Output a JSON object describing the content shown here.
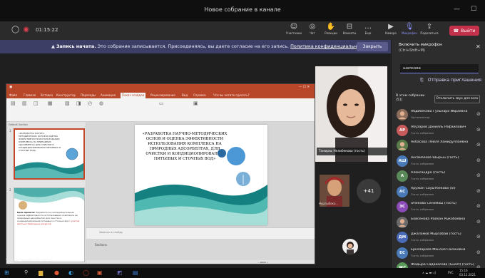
{
  "titlebar": {
    "title": "Новое собрание в канале"
  },
  "toolbar": {
    "timer": "01:15:22",
    "participants": "Участники",
    "chat": "Чат",
    "reactions": "Реакции",
    "rooms": "Комнаты",
    "more": "Еще",
    "camera": "Камера",
    "mic": "Микрофон",
    "share": "Поделиться",
    "leave": "Выйти"
  },
  "banner": {
    "bold": "Запись начата.",
    "text": "Это собрание записывается. Присоединяясь, вы даете согласие на его запись.",
    "link": "Политика конфиденциальности",
    "close": "Закрыть"
  },
  "ppt": {
    "tabs": [
      "Файл",
      "Главная",
      "Вставка",
      "Конструктор",
      "Переходы",
      "Анимация",
      "Показ слайдов",
      "Рецензирование",
      "Вид",
      "Справка",
      "Что вы хотите сделать?"
    ],
    "active_tab": "Показ слайдов",
    "slide_title": "«РАЗРАБОТКА НАУЧНО-МЕТОДИЧЕСКИХ ОСНОВ И ОЦЕНКА ЭФФЕКТИВНОСТИ ИСПОЛЬЗОВАНИЯ КОМПЛЕКСА НА ПРИРОДНЫХ АДСОРБЕНТАХ, ДЛЯ ОЧИСТКИ И КОНДИЦИОНИРОВАНИЯ ПИТЬЕВЫХ И СТОЧНЫХ ВОД»",
    "thumb1_text": "«РАЗРАБОТКА НАУЧНО-МЕТОДИЧЕСКИХ ОСНОВ И ОЦЕНКА ЭФФЕКТИВНОСТИ ИСПОЛЬЗОВАНИЯ КОМПЛЕКСА НА ПРИРОДНЫХ АДСОРБЕНТАХ ДЛЯ ОЧИСТКИ И КОНДИЦИОНИРОВАНИЯ ПИТЬЕВЫХ И СТОЧНЫХ ВОД»",
    "thumb2_bold": "Цель проекта:",
    "thumb2_text": "Разработка и экспериментальная оценка эффективности использования комплекса на природных адсорбентах для очистки и кондиционирования питьевых и сточных вод",
    "thumb2_red": "с учетом местных природных ресурсов",
    "notes_placeholder": "Заметки к слайду",
    "sections": "Sections",
    "default_section": "Default Section",
    "slide_num1": "1",
    "slide_num2": "2"
  },
  "stage": {
    "presenter_label": "Томирис Нелибекова (гость)",
    "cam_label": "Томирис Нелибекова (гость)",
    "cam2_label": "Нурлыбеко...",
    "more_count": "+41"
  },
  "panel": {
    "header_line1": "Включить микрофон",
    "header_line2": "(Ctrl+Shift+M)",
    "search_value": "шапкова",
    "invite": "Отправка приглашения",
    "group_label": "В этом собрании (51)",
    "mute_all": "Отключить звук для всех",
    "participants": [
      {
        "initials": "",
        "name": "Абдибекова Гульнара Ибраевна",
        "role": "Организатор",
        "color": "#8a6d5a",
        "photo": true
      },
      {
        "initials": "АР",
        "name": "Абузаров Данияль Рафаилович",
        "role": "Гость собрания",
        "color": "#c75a5a",
        "photo": false
      },
      {
        "initials": "",
        "name": "Акбасова Лейля Хамидуллаевна",
        "role": "",
        "color": "#5a7b4a",
        "photo": true
      },
      {
        "initials": "АШ",
        "name": "Аксамазова Шырын (гость)",
        "role": "Гость собрания",
        "color": "#4a7ab8",
        "photo": false
      },
      {
        "initials": "А",
        "name": "Александра (гость)",
        "role": "Гость собрания",
        "color": "#5a8a5a",
        "photo": false
      },
      {
        "initials": "АС",
        "name": "Аружан Сауытбекова (SI)",
        "role": "Гость собрания",
        "color": "#4a7ab8",
        "photo": false
      },
      {
        "initials": "ЭС",
        "name": "Әнекова Сенимаш (гость)",
        "role": "Гость собрания",
        "color": "#8a4ab8",
        "photo": false
      },
      {
        "initials": "",
        "name": "Бойсенова Райхан Рыкабаевна",
        "role": "",
        "color": "#6a6a6a",
        "photo": true
      },
      {
        "initials": "ДМ",
        "name": "Джаламов Мырзабай (гость)",
        "role": "Гость собрания",
        "color": "#4a6ab8",
        "photo": false
      },
      {
        "initials": "ЕС",
        "name": "Ерназарова Мансия Сахановна",
        "role": "Гость собрания",
        "color": "#4a7ab8",
        "photo": false
      },
      {
        "initials": "ЖС",
        "name": "Жадыра Садакасова (Guest) (гость)",
        "role": "Гость собрания",
        "color": "#5a9a5a",
        "photo": false
      }
    ]
  },
  "taskbar": {
    "lang": "РУС",
    "time": "15:16",
    "date": "03.12.2021"
  }
}
